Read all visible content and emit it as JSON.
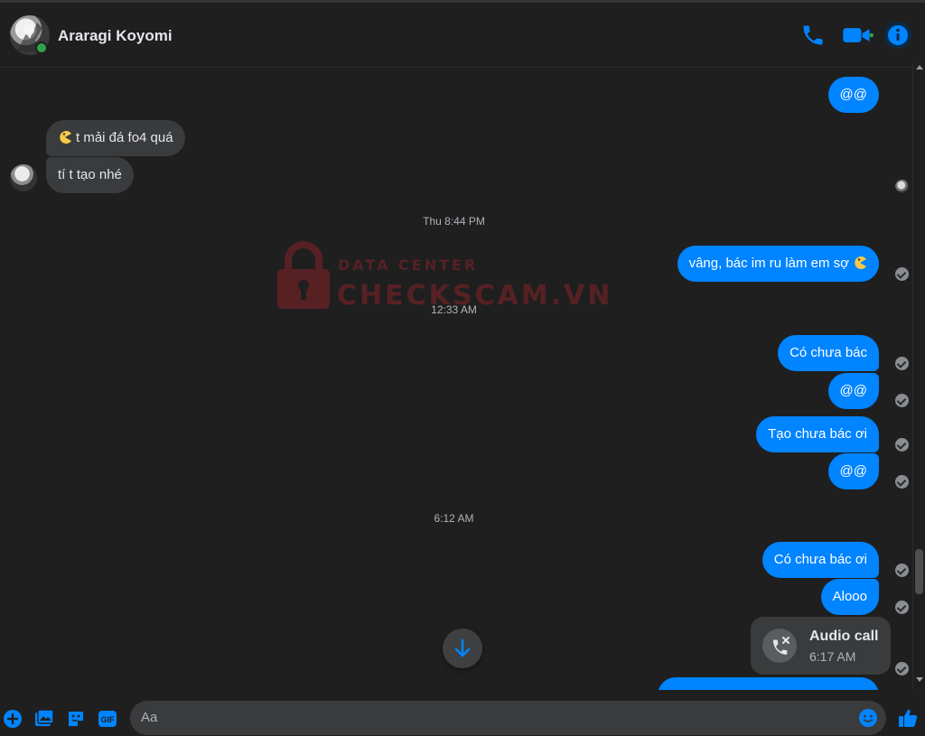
{
  "header": {
    "contact_name": "Araragi Koyomi",
    "status": "online",
    "icons": [
      "phone-icon",
      "video-icon",
      "info-icon"
    ],
    "accent_color": "#0084ff"
  },
  "messages": {
    "out_1": "@@",
    "in_1": "t mải đá fo4 quá",
    "in_2": "tí t tạo nhé",
    "time_1": "Thu 8:44 PM",
    "out_2": "vâng, bác im ru làm em sợ",
    "time_2": "12:33 AM",
    "out_3": "Có chưa bác",
    "out_4": "@@",
    "out_5": "Tạo chưa bác ơi",
    "out_6": "@@",
    "time_3": "6:12 AM",
    "out_7": "Có chưa bác ơi",
    "out_8": "Alooo"
  },
  "audio_call": {
    "title": "Audio call",
    "time": "6:17 AM"
  },
  "watermark": {
    "top": "DATA CENTER",
    "main": "CHECKSCAM.VN"
  },
  "composer": {
    "placeholder": "Aa",
    "icons": [
      "plus-icon",
      "image-icon",
      "sticker-icon",
      "gif-icon",
      "emoji-icon",
      "thumbs-up-icon"
    ]
  }
}
